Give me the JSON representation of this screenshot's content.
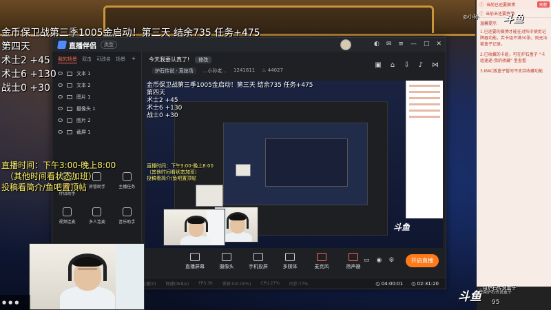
{
  "overlay": {
    "line1": "金币保卫战第三季1005金启动！第三天 结余735 任务+475",
    "line2": "第四天",
    "line3": "术士2 +45",
    "line4": "术士6 +130",
    "line5": "战士0 +30",
    "time1": "直播时间：下午3:00-晚上8:00",
    "time2": "（其他时间看状态加班）",
    "time3": "投稿看简介/鱼吧置顶帖"
  },
  "app": {
    "name": "直播伴侣",
    "badge": "类型",
    "sidebar_tabs": [
      "我的场景",
      "双击",
      "可改名",
      "场景"
    ],
    "layers": [
      "文本 1",
      "文本 2",
      "图片 1",
      "摄像头 1",
      "图片 2",
      "截屏 1"
    ],
    "tools": [
      {
        "label": "伴侣助手",
        "tag": "新"
      },
      {
        "label": "房管助手"
      },
      {
        "label": "主播任务"
      },
      {
        "label": "视频连麦"
      },
      {
        "label": "多人连麦"
      },
      {
        "label": "音乐助手"
      }
    ],
    "stream_title": "今天我要认真了!",
    "edit_label": "修改",
    "category": "炉石传说 · 竞技场",
    "user": "...小孙老...",
    "room_id": "1241611",
    "hot": "44027",
    "controls": [
      "直播屏幕",
      "摄像头",
      "手机投屏",
      "多媒体",
      "麦克风",
      "扬声器"
    ],
    "live_button": "开启直播",
    "status_left": [
      "直播(0)",
      "网速(0KB/s)",
      "FPS:30",
      "丢帧:0(0.00%)",
      "CPU:27%",
      "内存:77%"
    ],
    "time_a": "04:00:01",
    "time_b": "02:31:20"
  },
  "preview": {
    "line1": "金币保卫战第三季1005金启动！第三天 结余735 任务+475",
    "line2": "第四天",
    "line3": "术士2 +45",
    "line4": "术士6 +130",
    "line5": "战士0 +30",
    "y1": "直播时间：下午3:00-晚上8:00",
    "y2": "（其他时间看状态加班）",
    "y3": "投稿看简介/鱼吧置顶帖",
    "logo": "斗鱼"
  },
  "right_panel": {
    "top_label": "当前已还要赛博",
    "top_btn": "刷新",
    "section": "当前未还要赛博",
    "tip_title": "温馨提示",
    "tips": [
      "1.已还要的赛博才能在对阵中使用记牌器功能，若卡组不满30张，则无法被盒子记录。",
      "2.已收藏的卡组，可在炉石盒子 \"卡组速递-我的收藏\" 里查看",
      "3.MAC版盒子暂时不支持收藏功能"
    ],
    "footer": "使用炉石传说盒子"
  },
  "brand": {
    "logo": "斗鱼",
    "id": "小孙",
    "gift_text": "...用炉石传说盒子",
    "number": "95"
  }
}
